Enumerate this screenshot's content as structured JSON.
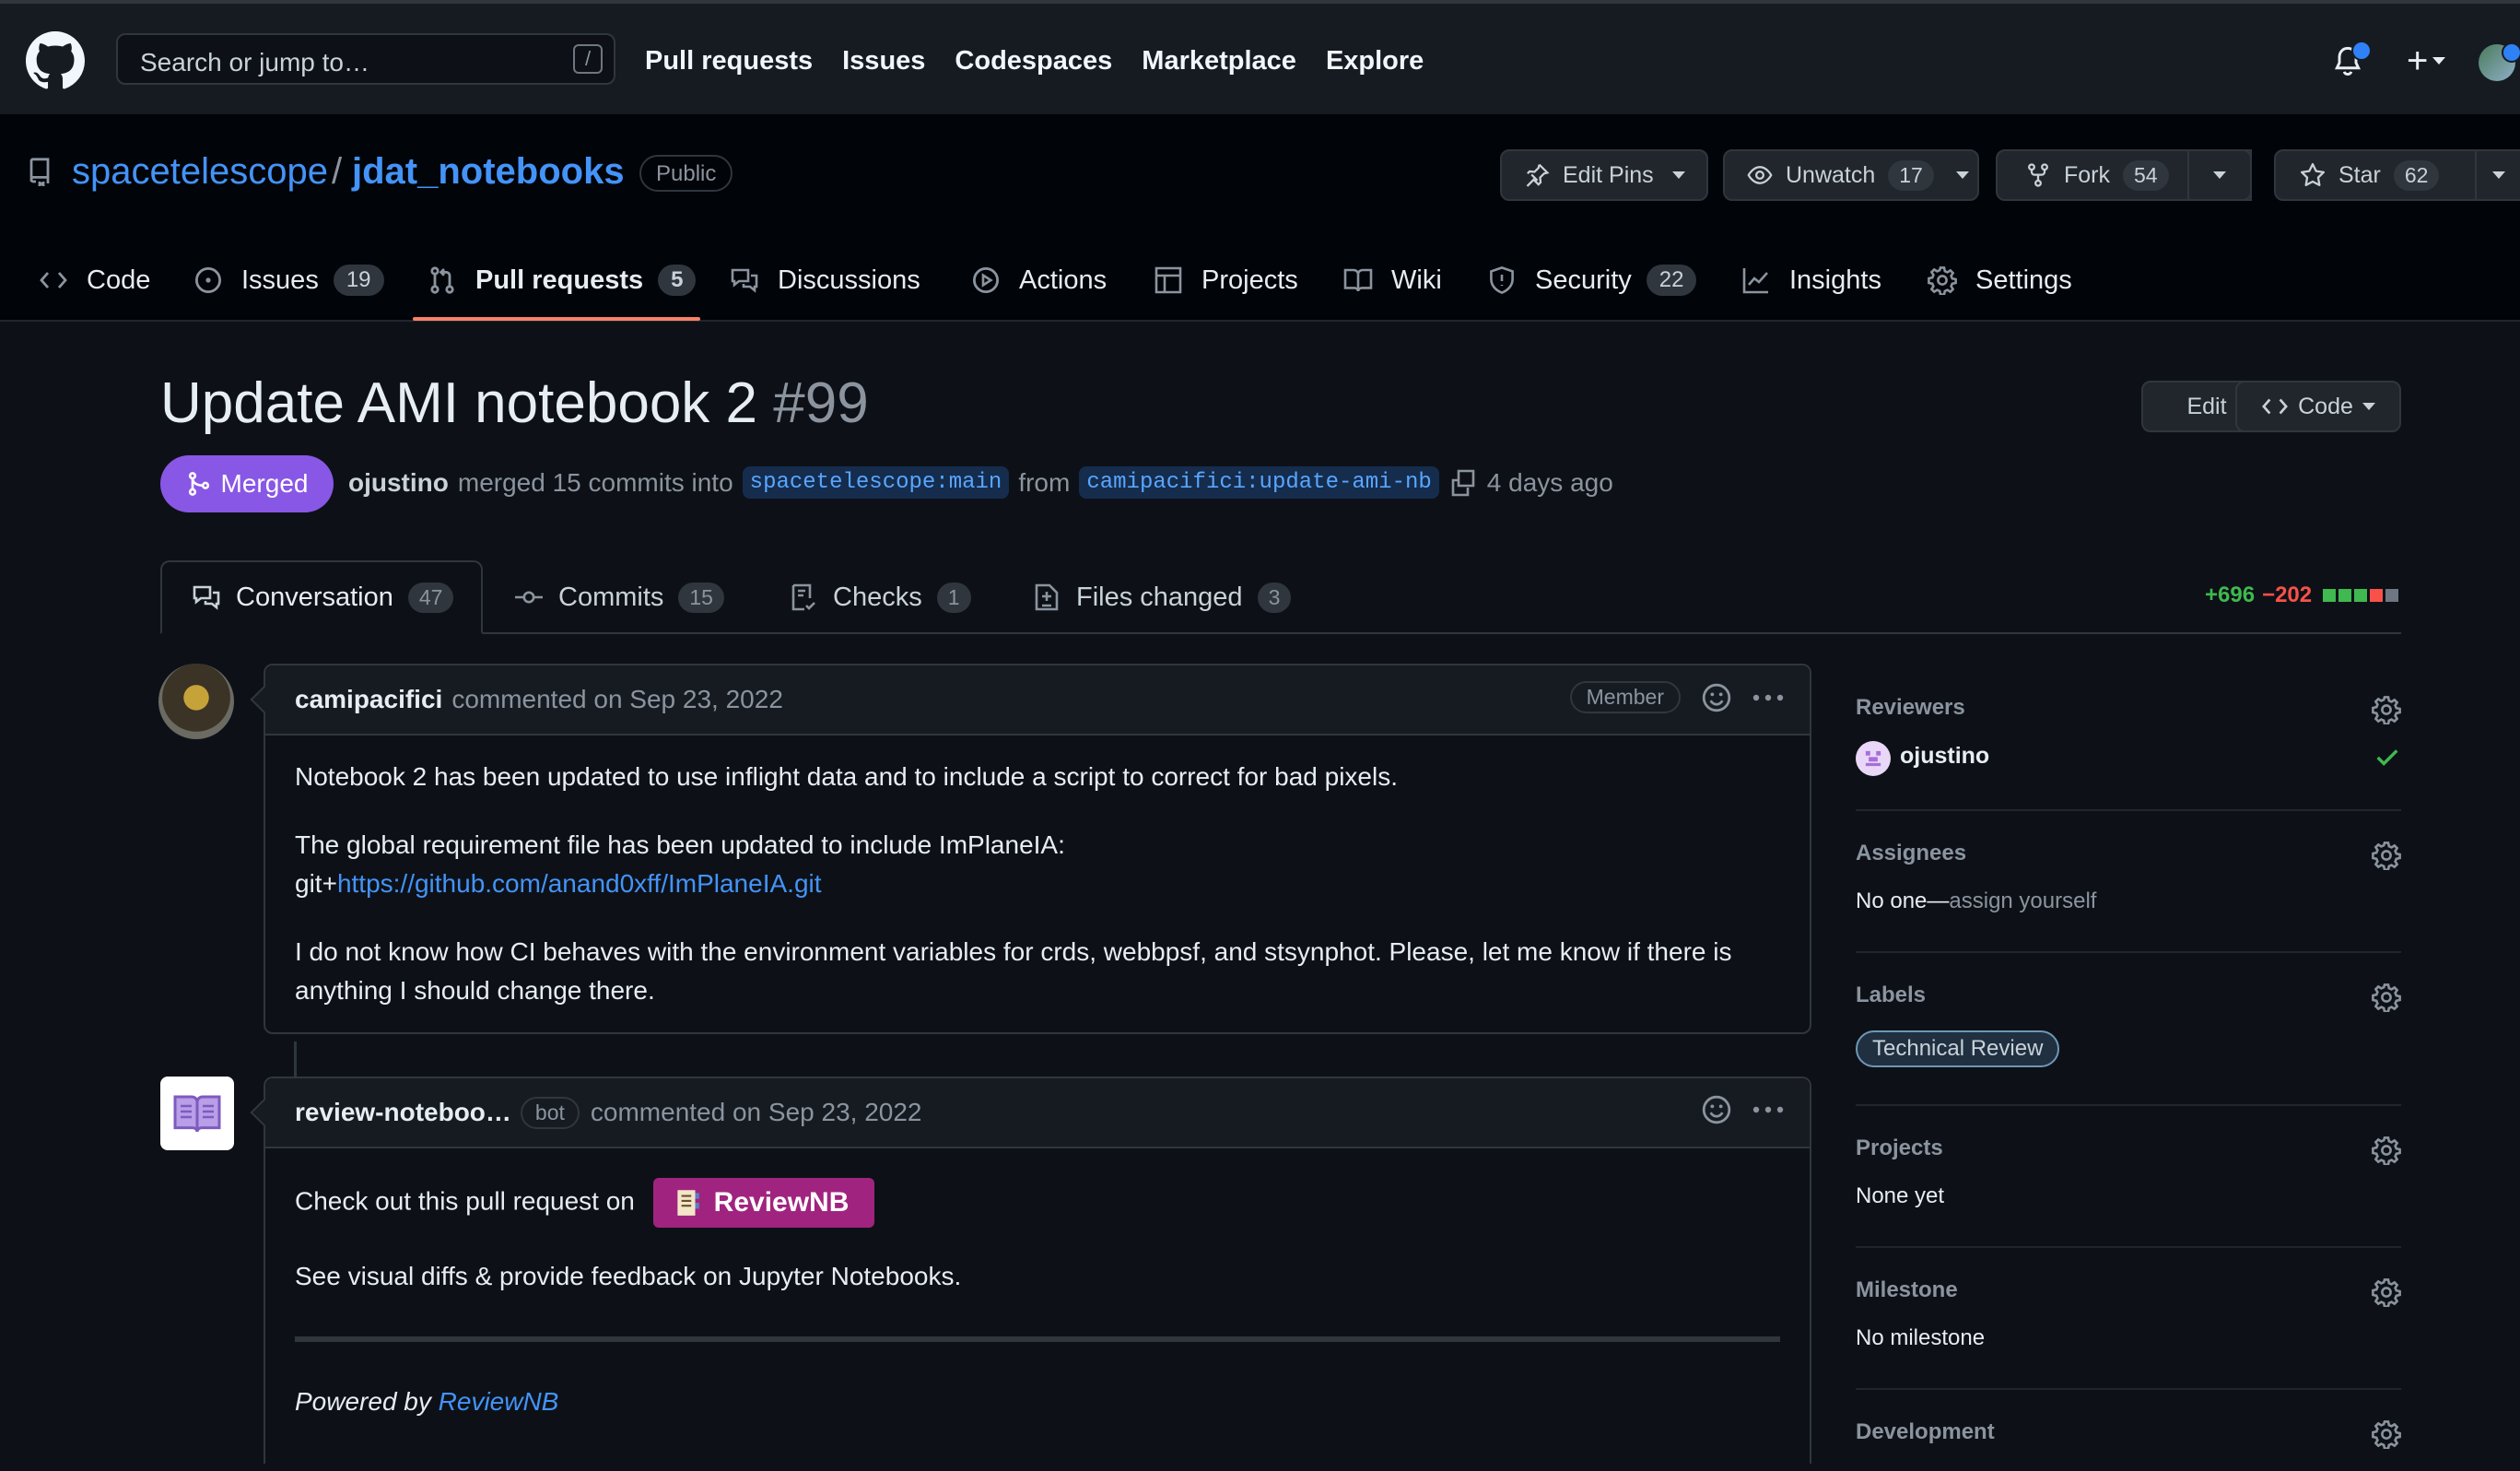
{
  "header": {
    "search_placeholder": "Search or jump to…",
    "search_shortcut": "/",
    "nav": [
      "Pull requests",
      "Issues",
      "Codespaces",
      "Marketplace",
      "Explore"
    ],
    "plus": "+"
  },
  "repo": {
    "owner": "spacetelescope",
    "separator": "/",
    "name": "jdat_notebooks",
    "visibility": "Public",
    "edit_pins": "Edit Pins",
    "unwatch": "Unwatch",
    "watch_count": "17",
    "fork": "Fork",
    "fork_count": "54",
    "star": "Star",
    "star_count": "62",
    "tabs": [
      {
        "label": "Code",
        "count": null
      },
      {
        "label": "Issues",
        "count": "19"
      },
      {
        "label": "Pull requests",
        "count": "5"
      },
      {
        "label": "Discussions",
        "count": null
      },
      {
        "label": "Actions",
        "count": null
      },
      {
        "label": "Projects",
        "count": null
      },
      {
        "label": "Wiki",
        "count": null
      },
      {
        "label": "Security",
        "count": "22"
      },
      {
        "label": "Insights",
        "count": null
      },
      {
        "label": "Settings",
        "count": null
      }
    ]
  },
  "pr": {
    "title": "Update AMI notebook 2",
    "number": "#99",
    "edit": "Edit",
    "code": "Code",
    "state": "Merged",
    "author": "ojustino",
    "merged_text": "merged 15 commits into",
    "base": "spacetelescope:main",
    "from_text": "from",
    "head": "camipacifici:update-ami-nb",
    "time": "4 days ago",
    "tabs": [
      {
        "label": "Conversation",
        "count": "47"
      },
      {
        "label": "Commits",
        "count": "15"
      },
      {
        "label": "Checks",
        "count": "1"
      },
      {
        "label": "Files changed",
        "count": "3"
      }
    ],
    "additions": "+696",
    "deletions": "−202",
    "diff_blocks": [
      "#3fb950",
      "#3fb950",
      "#3fb950",
      "#f85149",
      "#6e7681"
    ]
  },
  "comments": [
    {
      "author": "camipacifici",
      "action": "commented on Sep 23, 2022",
      "role": "Member",
      "p1": "Notebook 2 has been updated to use inflight data and to include a script to correct for bad pixels.",
      "p2_line1": "The global requirement file has been updated to include ImPlaneIA:",
      "p2_prefix": "git+",
      "p2_link": "https://github.com/anand0xff/ImPlaneIA.git",
      "p3": "I do not know how CI behaves with the environment variables for crds, webbpsf, and stsynphot. Please, let me know if there is anything I should change there."
    },
    {
      "author": "review-noteboo…",
      "tag": "bot",
      "action": "commented on Sep 23, 2022",
      "p1": "Check out this pull request on",
      "button": "ReviewNB",
      "p2": "See visual diffs & provide feedback on Jupyter Notebooks.",
      "powered_prefix": "Powered by",
      "powered_link": "ReviewNB"
    }
  ],
  "sidebar": {
    "reviewers_title": "Reviewers",
    "reviewer": "ojustino",
    "assignees_title": "Assignees",
    "assignees_value": "No one—",
    "assignees_link": "assign yourself",
    "labels_title": "Labels",
    "label": "Technical Review",
    "projects_title": "Projects",
    "projects_value": "None yet",
    "milestone_title": "Milestone",
    "milestone_value": "No milestone",
    "development_title": "Development"
  }
}
